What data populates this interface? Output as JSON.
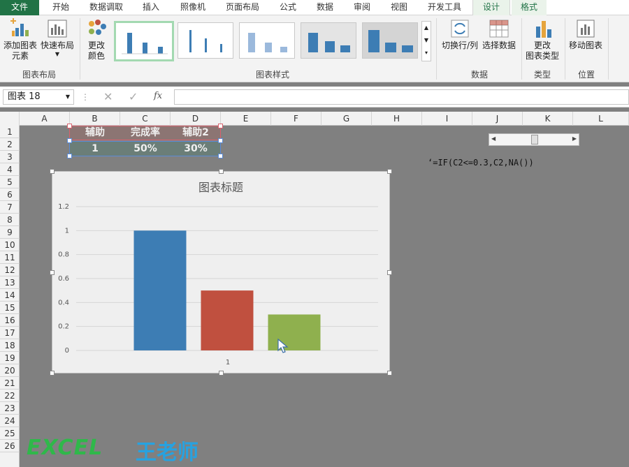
{
  "tabs": [
    "文件",
    "开始",
    "数据调取",
    "插入",
    "照像机",
    "页面布局",
    "公式",
    "数据",
    "审阅",
    "视图",
    "开发工具",
    "设计",
    "格式"
  ],
  "ribbon": {
    "add_element": "添加图表\n元素",
    "quick_layout": "快速布局",
    "change_colors": "更改\n颜色",
    "switch_rowcol": "切换行/列",
    "select_data": "选择数据",
    "change_type": "更改\n图表类型",
    "move_chart": "移动图表",
    "groups": {
      "layout": "图表布局",
      "styles": "图表样式",
      "data": "数据",
      "type": "类型",
      "location": "位置"
    }
  },
  "formula_bar": {
    "name_box": "图表 18",
    "fx": "fx",
    "value": ""
  },
  "columns": [
    "A",
    "B",
    "C",
    "D",
    "E",
    "F",
    "G",
    "H",
    "I",
    "J",
    "K",
    "L"
  ],
  "rows": [
    "1",
    "2",
    "3",
    "4",
    "5",
    "6",
    "7",
    "8",
    "9",
    "10",
    "11",
    "12",
    "13",
    "14",
    "15",
    "16",
    "17",
    "18",
    "19",
    "20",
    "21",
    "22",
    "23",
    "24",
    "25",
    "26"
  ],
  "table": {
    "headers": [
      "辅助",
      "完成率",
      "辅助2"
    ],
    "values": [
      "1",
      "50%",
      "30%"
    ]
  },
  "annotation": "‘=IF(C2<=0.3,C2,NA())",
  "watermark": {
    "left": "EXCEL",
    "right": "王老师"
  },
  "chart_data": {
    "type": "bar",
    "title": "图表标题",
    "categories": [
      "1"
    ],
    "series": [
      {
        "values": [
          1
        ],
        "color": "#3d7db4"
      },
      {
        "values": [
          0.5
        ],
        "color": "#c0503f"
      },
      {
        "values": [
          0.3
        ],
        "color": "#8fb04e"
      }
    ],
    "ylim": [
      0,
      1.2
    ],
    "yticks": [
      "0",
      "0.2",
      "0.4",
      "0.6",
      "0.8",
      "1",
      "1.2"
    ],
    "grid": true
  },
  "colors": {
    "excel_green": "#217346",
    "sheet_bg": "#808080",
    "header_row_bg": "#8c7573",
    "value_row_bg": "#6b7e78"
  }
}
